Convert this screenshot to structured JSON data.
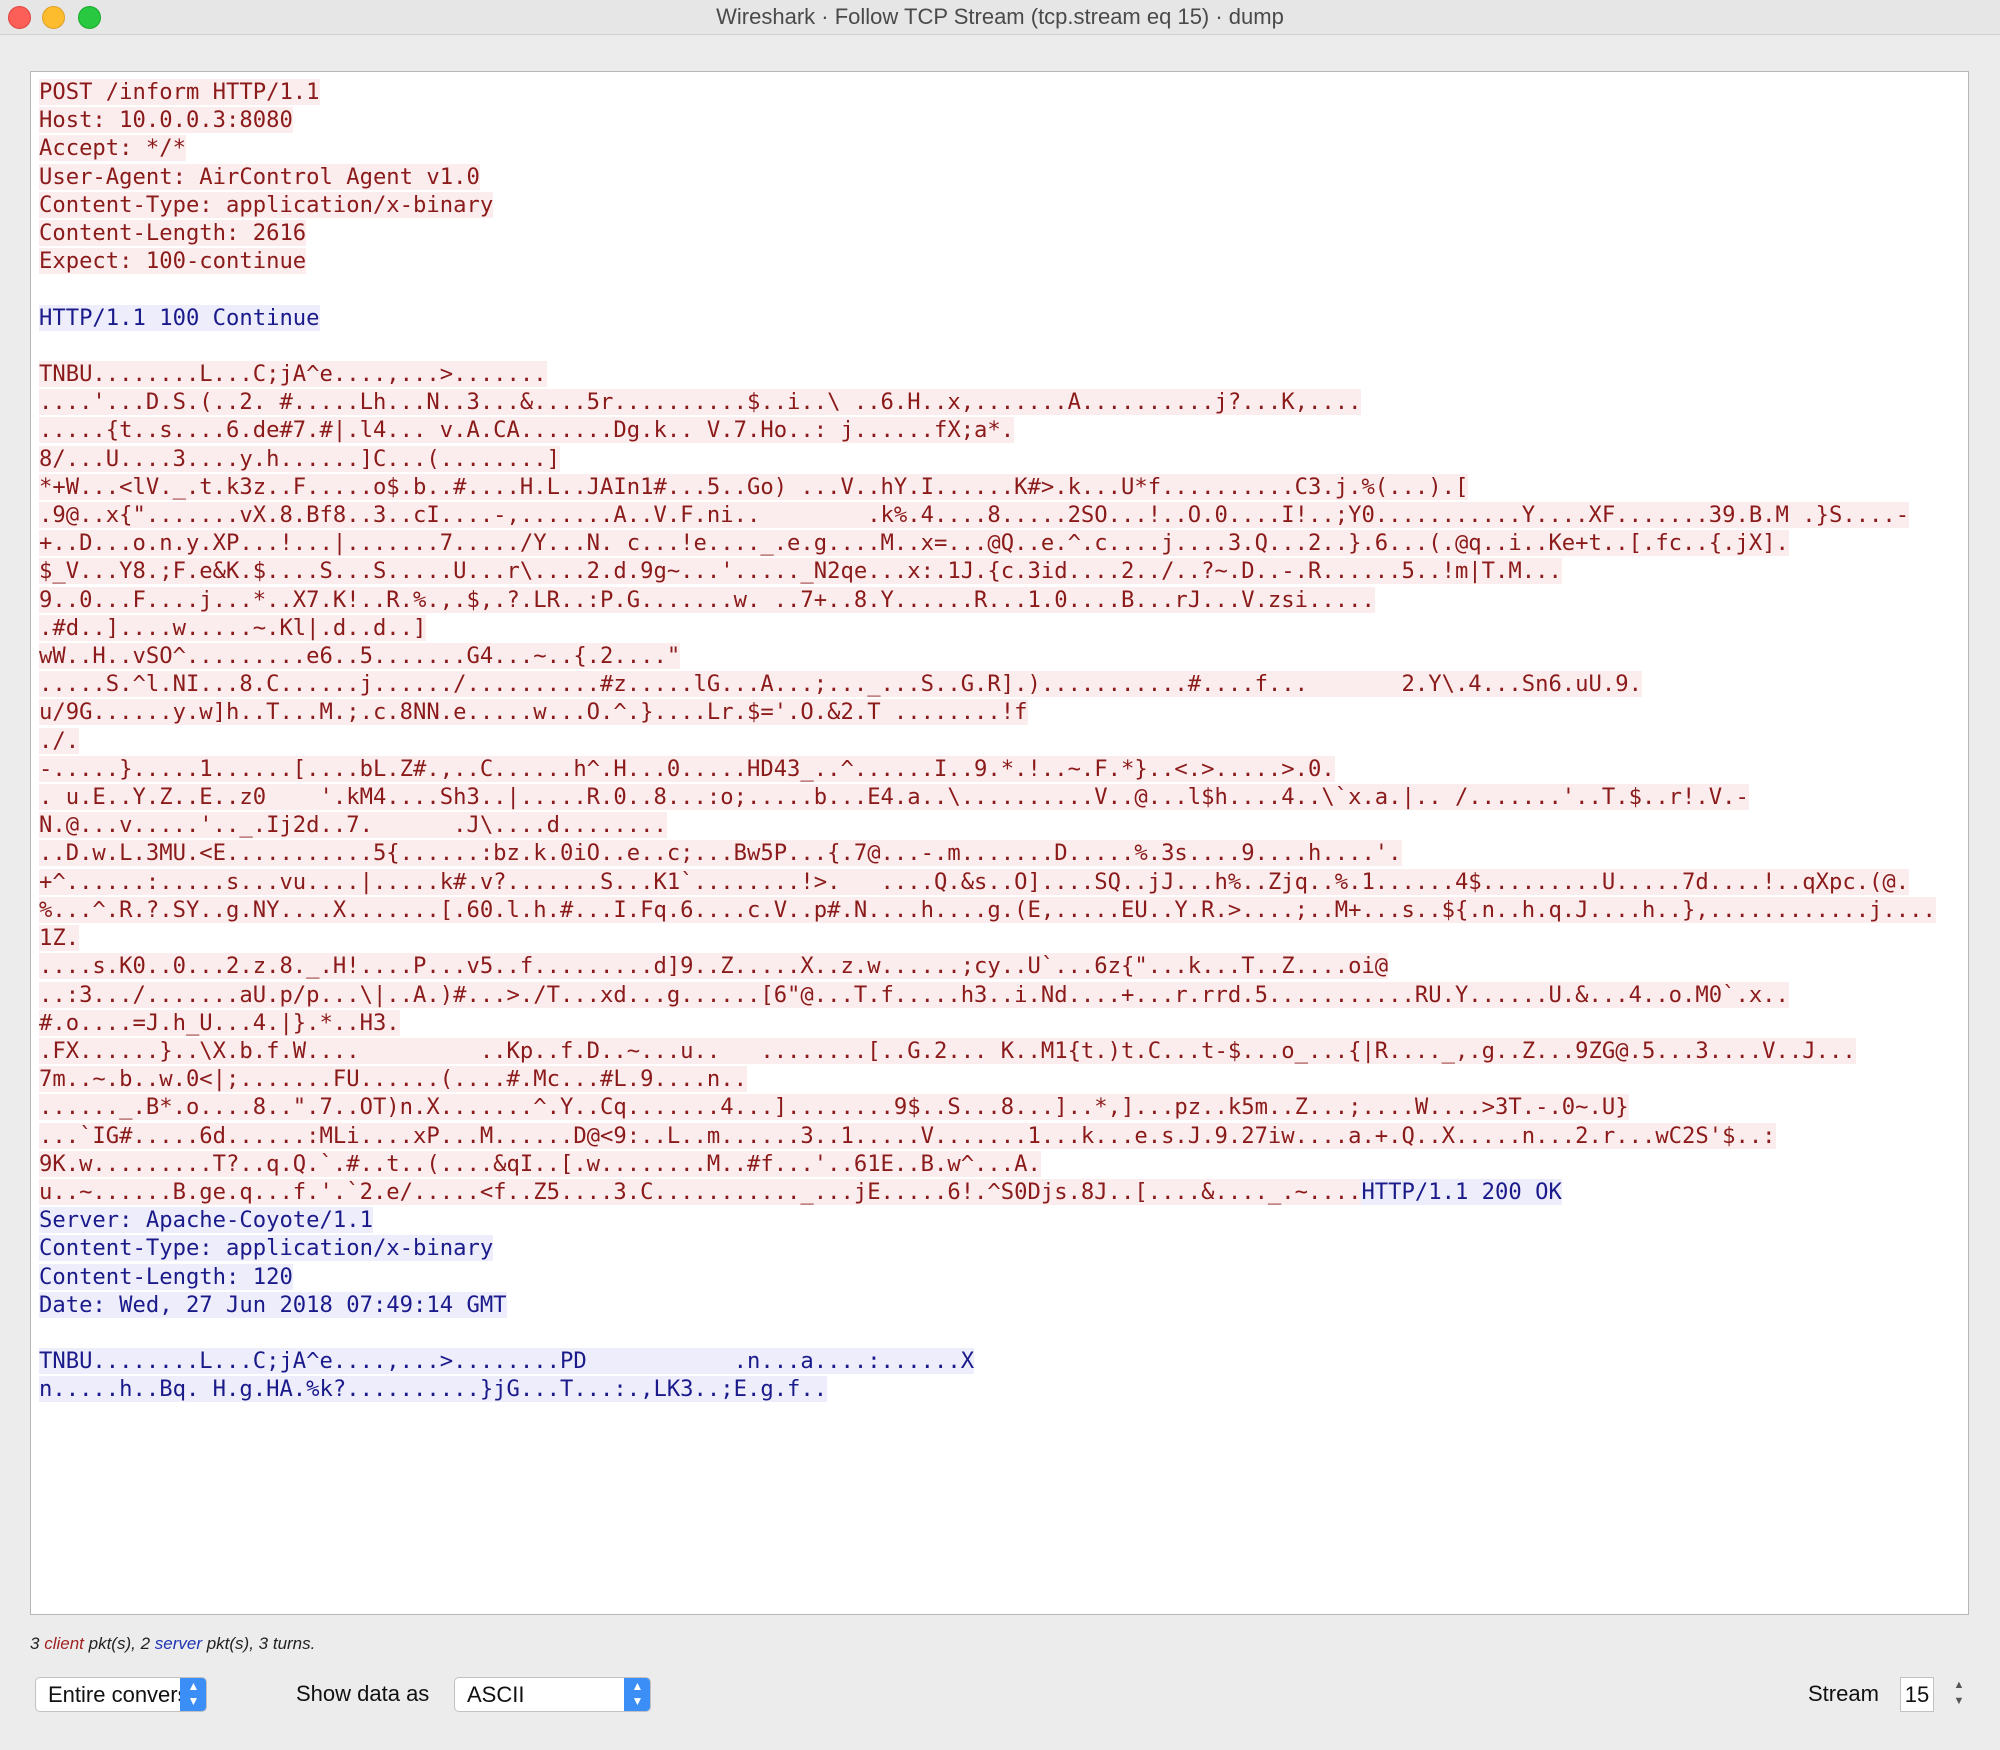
{
  "window": {
    "title": "Wireshark · Follow TCP Stream (tcp.stream eq 15) · dump"
  },
  "colors": {
    "client_bg": "#fbeded",
    "client_fg": "#8b1a1a",
    "server_bg": "#ededfb",
    "server_fg": "#1a1a8b"
  },
  "stream": {
    "segments": [
      {
        "dir": "c",
        "text": "POST /inform HTTP/1.1\nHost: 10.0.0.3:8080\nAccept: */*\nUser-Agent: AirControl Agent v1.0\nContent-Type: application/x-binary\nContent-Length: 2616\nExpect: 100-continue\n\n"
      },
      {
        "dir": "s",
        "text": "HTTP/1.1 100 Continue\n\n"
      },
      {
        "dir": "c",
        "text": "TNBU........L...C;jA^e....,...>.......\n....'...D.S.(..2. #.....Lh...N..3...&....5r..........$..i..\\ ..6.H..x,.......A..........j?...K,....\n.....{t..s....6.de#7.#|.l4... v.A.CA.......Dg.k.. V.7.Ho..: j......fX;a*.\n8/...U....3....y.h......]C...(........]\n*+W...<lV._.t.k3z..F.....o$.b..#....H.L..JAIn1#...5..Go) ...V..hY.I......K#>.k...U*f..........C3.j.%(...).[\n.9@..x{\".......vX.8.Bf8..3..cI....-,.......A..V.F.ni..        .k%.4....8.....2SO...!..O.0....I!..;Y0...........Y....XF.......39.B.M .}S....-\n+..D...o.n.y.XP...!...|.......7...../Y...N. c...!e...._.e.g....M..x=...@Q..e.^.c....j....3.Q...2..}.6...(.@q..i..Ke+t..[.fc..{.jX].\n$_V...Y8.;F.e&K.$....S...S.....U...r\\....2.d.9g~...'....._N2qe...x:.1J.{c.3id....2../..?~.D..-.R......5..!m|T.M...\n9..0...F....j...*..X7.K!..R.%.,.$,.?.LR..:P.G.......w. ..7+..8.Y......R...1.0....B...rJ...V.zsi.....\n.#d..]....w.....~.Kl|.d..d..]\nwW..H..vSO^.........e6..5.......G4...~..{.2....\"\n.....S.^l.NI...8.C......j....../..........#z.....lG...A...;..._...S..G.R].)...........#....f...       2.Y\\.4...Sn6.uU.9.\nu/9G......y.w]h..T...M.;.c.8NN.e.....w...O.^.}....Lr.$='.O.&2.T ........!f\n./.\n-.....}.....1......[....bL.Z#.,..C......h^.H...0.....HD43_..^......I..9.*.!..~.F.*}..<.>.....>.0.\n. u.E..Y.Z..E..z0    '.kM4....Sh3..|.....R.0..8...:o;.....b...E4.a..\\..........V..@...l$h....4..\\`x.a.|.. /.......'..T.$..r!.V.-\nN.@...v.....'.._.Ij2d..7.      .J\\....d........\n..D.w.L.3MU.<E...........5{......:bz.k.0iO..e..c;...Bw5P...{.7@...-.m.......D.....%.3s....9....h....'.\n+^......:.....s...vu....|.....k#.v?.......S...K1`........!>.   ....Q.&s..O]....SQ..jJ...h%..Zjq..%.1......4$.........U.....7d....!..qXpc.(@.\n%...^.R.?.SY..g.NY....X.......[.60.l.h.#...I.Fq.6....c.V..p#.N....h....g.(E,.....EU..Y.R.>....;..M+...s..${.n..h.q.J....h..},............j....\n1Z.\n....s.K0..0...2.z.8._.H!....P...v5..f.........d]9..Z.....X..z.w......;cy..U`...6z{\"...k...T..Z....oi@\n..:3.../.......aU.p/p...\\|..A.)#...>./T...xd...g......[6\"@...T.f.....h3..i.Nd....+...r.rrd.5...........RU.Y......U.&...4..o.M0`.x..\n#.o....=J.h_U...4.|}.*..H3.\n.FX......}..\\X.b.f.W....         ..Kp..f.D..~...u..   ........[..G.2... K..M1{t.)t.C...t-$...o_...{|R...._,.g..Z...9ZG@.5...3....V..J...\n7m..~.b..w.0<|;.......FU......(....#.Mc...#L.9....n..\n......_.B*.o....8..\".7..OT)n.X.......^.Y..Cq.......4...]........9$..S...8...]..*,]...pz..k5m..Z...;....W....>3T.-.0~.U}\n...`IG#.....6d......:MLi....xP...M......D@<9:..L..m......3..1.....V.......1...k...e.s.J.9.27iw....a.+.Q..X.....n...2.r...wC2S'$..:\n9K.w.........T?..q.Q.`.#..t..(....&qI..[.w........M..#f...'..61E..B.w^...A.\nu..~......B.ge.q...f.'.`2.e/.....<f..Z5....3.C..........._...jE.....6!.^S0Djs.8J..[....&...._.~...."
      },
      {
        "dir": "s",
        "text": "HTTP/1.1 200 OK\nServer: Apache-Coyote/1.1\nContent-Type: application/x-binary\nContent-Length: 120\nDate: Wed, 27 Jun 2018 07:49:14 GMT\n\nTNBU........L...C;jA^e....,...>........PD           .n...a....:......X\nn.....h..Bq. H.g.HA.%k?..........}jG...T...:.,LK3..;E.g.f.."
      }
    ]
  },
  "status": {
    "client_count": "3",
    "client_word": "client",
    "middle": " pkt(s), ",
    "server_count": "2",
    "server_word": "server",
    "tail": " pkt(s), 3 turns."
  },
  "controls": {
    "conversation_value": "Entire conversation",
    "show_data_label": "Show data as",
    "show_data_value": "ASCII",
    "stream_label": "Stream",
    "stream_value": "15"
  }
}
